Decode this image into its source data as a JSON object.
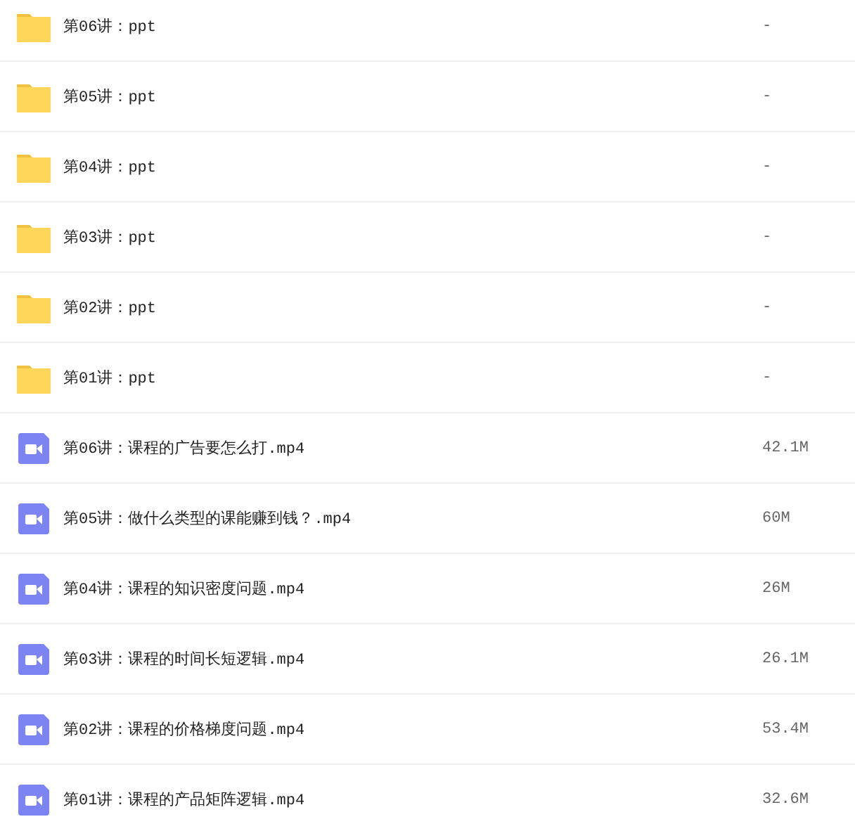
{
  "files": [
    {
      "kind": "folder",
      "name": "第06讲：ppt",
      "size": "-"
    },
    {
      "kind": "folder",
      "name": "第05讲：ppt",
      "size": "-"
    },
    {
      "kind": "folder",
      "name": "第04讲：ppt",
      "size": "-"
    },
    {
      "kind": "folder",
      "name": "第03讲：ppt",
      "size": "-"
    },
    {
      "kind": "folder",
      "name": "第02讲：ppt",
      "size": "-"
    },
    {
      "kind": "folder",
      "name": "第01讲：ppt",
      "size": "-"
    },
    {
      "kind": "video",
      "name": "第06讲：课程的广告要怎么打.mp4",
      "size": "42.1M"
    },
    {
      "kind": "video",
      "name": "第05讲：做什么类型的课能赚到钱？.mp4",
      "size": "60M"
    },
    {
      "kind": "video",
      "name": "第04讲：课程的知识密度问题.mp4",
      "size": "26M"
    },
    {
      "kind": "video",
      "name": "第03讲：课程的时间长短逻辑.mp4",
      "size": "26.1M"
    },
    {
      "kind": "video",
      "name": "第02讲：课程的价格梯度问题.mp4",
      "size": "53.4M"
    },
    {
      "kind": "video",
      "name": "第01讲：课程的产品矩阵逻辑.mp4",
      "size": "32.6M"
    }
  ]
}
